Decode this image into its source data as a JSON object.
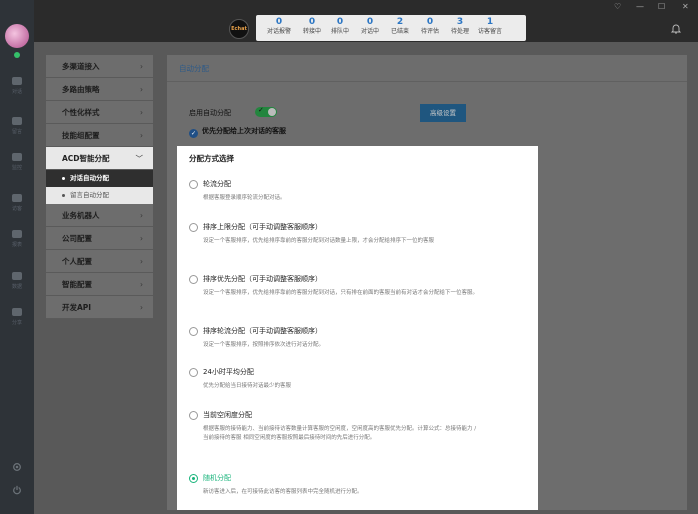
{
  "window": {
    "controls": [
      "♡",
      "—",
      "☐",
      "✕"
    ]
  },
  "rail": {
    "items": [
      {
        "icon": "chat-bubble-icon",
        "label": "对话"
      },
      {
        "icon": "mail-icon",
        "label": "留言"
      },
      {
        "icon": "eye-icon",
        "label": "监控"
      },
      {
        "icon": "contact-icon",
        "label": "访客"
      },
      {
        "icon": "report-icon",
        "label": "报表"
      },
      {
        "icon": "bar-chart-icon",
        "label": "数据"
      },
      {
        "icon": "share-icon",
        "label": "分享"
      }
    ]
  },
  "topbar": {
    "logo_text": "Echat",
    "stats": [
      {
        "value": "0",
        "label": "对话报警"
      },
      {
        "value": "0",
        "label": "转接中"
      },
      {
        "value": "0",
        "label": "排队中"
      },
      {
        "value": "0",
        "label": "对话中"
      },
      {
        "value": "2",
        "label": "已结束"
      },
      {
        "value": "0",
        "label": "待评估"
      },
      {
        "value": "3",
        "label": "待处理"
      },
      {
        "value": "1",
        "label": "访客留言"
      }
    ]
  },
  "menu": {
    "items": [
      {
        "label": "多渠道接入",
        "chevron": "›"
      },
      {
        "label": "多路由策略",
        "chevron": "›"
      },
      {
        "label": "个性化样式",
        "chevron": "›"
      },
      {
        "label": "技能组配置",
        "chevron": "›"
      }
    ],
    "active": {
      "label": "ACD智能分配",
      "chevron": "﹀"
    },
    "subitems": [
      {
        "label": "对话自动分配",
        "selected": true
      },
      {
        "label": "留言自动分配",
        "selected": false
      }
    ],
    "items_after": [
      {
        "label": "业务机器人",
        "chevron": "›"
      },
      {
        "label": "公司配置",
        "chevron": "›"
      },
      {
        "label": "个人配置",
        "chevron": "›"
      },
      {
        "label": "智能配置",
        "chevron": "›"
      },
      {
        "label": "开发API",
        "chevron": "›"
      }
    ]
  },
  "panel": {
    "title": "自动分配",
    "enable_label": "启用自动分配",
    "enable_on": true,
    "priority_label": "优先分配给上次对话的客服",
    "advanced_button": "高级设置"
  },
  "card": {
    "title": "分配方式选择",
    "options": [
      {
        "name": "轮流分配",
        "desc": "根据客服登录顺序轮流分配对话。",
        "selected": false
      },
      {
        "name": "排序上限分配（可手动调整客服顺序）",
        "desc": "设定一个客服排序，优先给排序靠前的客服分配到对话数量上限，才会分配给排序下一位的客服",
        "selected": false
      },
      {
        "name": "排序优先分配（可手动调整客服顺序）",
        "desc": "设定一个客服排序，优先给排序靠前的客服分配到对话，只有排在前面的客服当前有对话才会分配给下一位客服。",
        "selected": false
      },
      {
        "name": "排序轮流分配（可手动调整客服顺序）",
        "desc": "设定一个客服排序，按照排序依次进行对话分配。",
        "selected": false
      },
      {
        "name": "24小时平均分配",
        "desc": "优先分配给当日接待对话最少的客服",
        "selected": false
      },
      {
        "name": "当前空闲度分配",
        "desc": "根据客服的接待能力、当前接待访客数量计算客服的空闲度，空闲度高的客服优先分配。计算公式：总接待能力 / 当前接待的客服 相同空闲度的客服按照最后接待时间的先后进行分配。",
        "selected": false
      },
      {
        "name": "随机分配",
        "desc": "新访客进入后，在可接待此访客的客服列表中完全随机进行分配。",
        "selected": true
      }
    ]
  },
  "colors": {
    "accent": "#2c76c3",
    "selected": "#18b47b",
    "toggle_on": "#23853e"
  }
}
